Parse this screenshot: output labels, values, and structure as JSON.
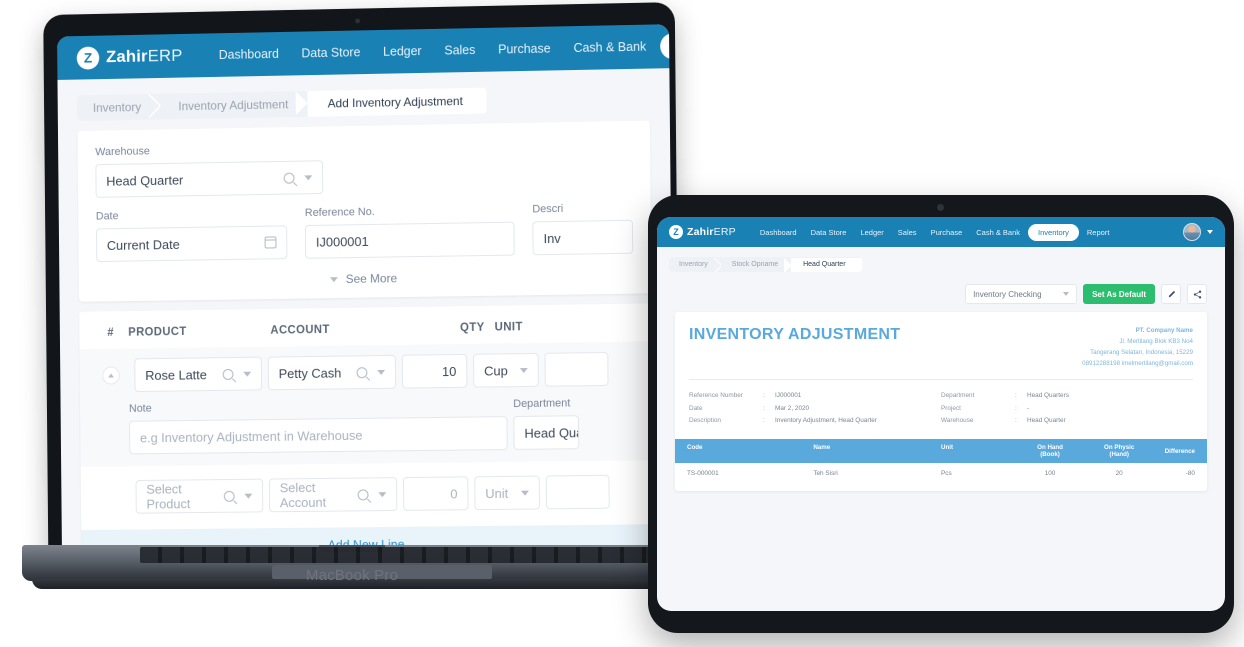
{
  "app": {
    "brand_bold": "Zahir",
    "brand_light": "ERP",
    "brand_initial": "Z",
    "nav": [
      "Dashboard",
      "Data Store",
      "Ledger",
      "Sales",
      "Purchase",
      "Cash & Bank",
      "Inventory",
      "Report"
    ],
    "nav_active": "Inventory",
    "accent_blue": "#1a81b5",
    "accent_green": "#2dbd6e",
    "doc_blue": "#5aa9dd"
  },
  "laptop": {
    "device_label": "MacBook Pro",
    "breadcrumbs": [
      "Inventory",
      "Inventory Adjustment",
      "Add Inventory Adjustment"
    ],
    "breadcrumb_active": "Add Inventory Adjustment",
    "form": {
      "warehouse_label": "Warehouse",
      "warehouse_value": "Head Quarter",
      "date_label": "Date",
      "date_value": "Current Date",
      "reference_label": "Reference No.",
      "reference_value": "IJ000001",
      "description_label": "Descri",
      "description_value": "Inv",
      "see_more": "See More"
    },
    "table": {
      "headers": [
        "#",
        "PRODUCT",
        "ACCOUNT",
        "QTY",
        "UNIT"
      ],
      "row": {
        "product": "Rose Latte",
        "account": "Petty Cash",
        "qty": "10",
        "unit": "Cup",
        "note_label": "Note",
        "note_placeholder": "e.g Inventory Adjustment in Warehouse",
        "department_label": "Department",
        "department_value": "Head Qua"
      },
      "empty_row": {
        "product_placeholder": "Select Product",
        "account_placeholder": "Select Account",
        "qty_placeholder": "0",
        "unit_placeholder": "Unit"
      },
      "add_new_line": "Add New Line"
    }
  },
  "tablet": {
    "breadcrumbs": [
      "Inventory",
      "Stock Opname",
      "Head Quarter"
    ],
    "breadcrumb_active": "Head Quarter",
    "toolbar": {
      "select_value": "Inventory Checking",
      "set_default_label": "Set As Default",
      "edit_icon": "pencil-icon",
      "share_icon": "share-icon"
    },
    "document": {
      "title": "INVENTORY ADJUSTMENT",
      "company_name": "PT. Company Name",
      "company_address1": "Jl. Mertilang Blok KB3 No4",
      "company_address2": "Tangerang Selatan, Indonesia, 15229",
      "company_contact": "08912288198 imelmertilang@gmail.com",
      "fields_left": [
        {
          "key": "Reference Number",
          "value": "IJ000001"
        },
        {
          "key": "Date",
          "value": "Mar 2, 2020"
        },
        {
          "key": "Description",
          "value": "Inventory Adjustment, Head Quarter"
        }
      ],
      "fields_right": [
        {
          "key": "Department",
          "value": "Head Quarters"
        },
        {
          "key": "Project",
          "value": "-"
        },
        {
          "key": "Warehouse",
          "value": "Head Quarter"
        }
      ],
      "table": {
        "headers": [
          "Code",
          "Name",
          "Unit",
          "On Hand\n(Book)",
          "On Physic\n(Hand)",
          "Difference"
        ],
        "header_code": "Code",
        "header_name": "Name",
        "header_unit": "Unit",
        "header_onhand_l1": "On Hand",
        "header_onhand_l2": "(Book)",
        "header_onphysic_l1": "On Physic",
        "header_onphysic_l2": "(Hand)",
        "header_difference": "Difference",
        "rows": [
          {
            "code": "TS-000001",
            "name": "Teh Sisri",
            "unit": "Pcs",
            "on_hand": "100",
            "on_physic": "20",
            "difference": "-80"
          }
        ]
      }
    }
  }
}
